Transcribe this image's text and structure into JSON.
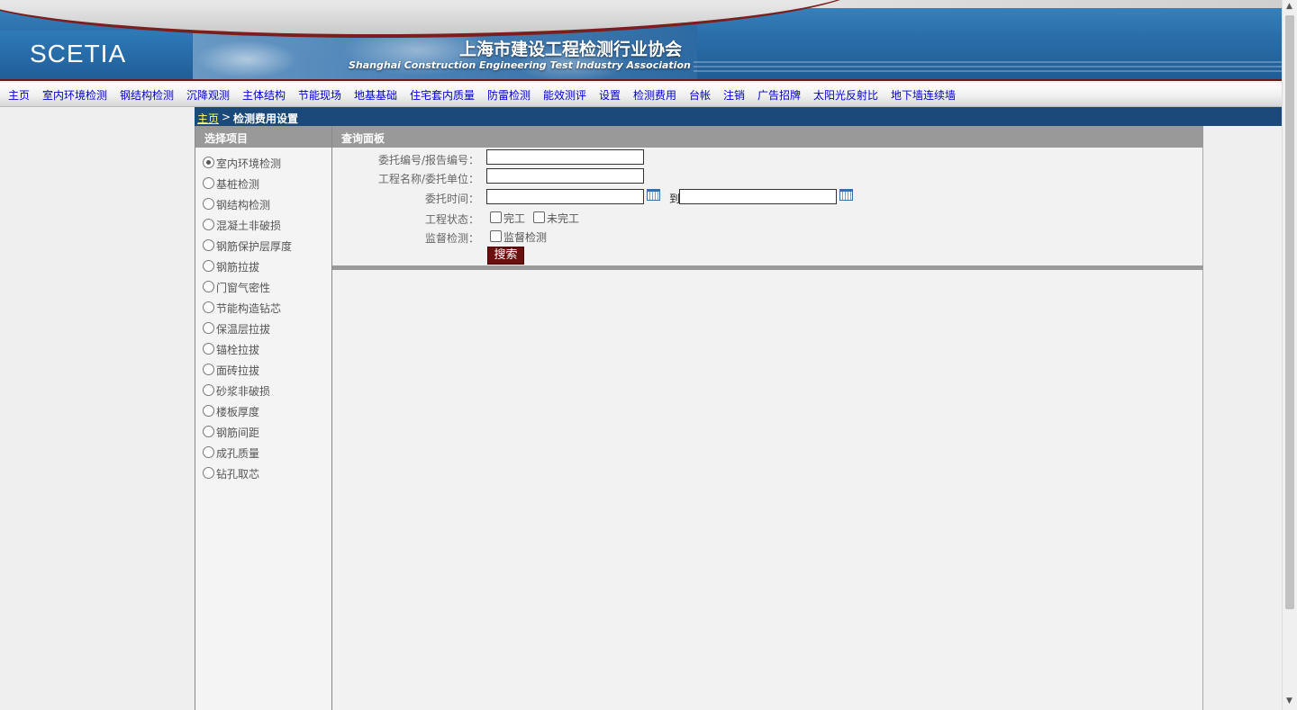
{
  "header": {
    "logo": "SCETIA",
    "title_cn": "上海市建设工程检测行业协会",
    "title_en": "Shanghai Construction Engineering Test Industry Association"
  },
  "nav": {
    "items": [
      {
        "label": "主页"
      },
      {
        "label": "室内环境检测"
      },
      {
        "label": "钢结构检测"
      },
      {
        "label": "沉降观测"
      },
      {
        "label": "主体结构"
      },
      {
        "label": "节能现场"
      },
      {
        "label": "地基基础"
      },
      {
        "label": "住宅套内质量"
      },
      {
        "label": "防雷检测"
      },
      {
        "label": "能效测评"
      },
      {
        "label": "设置"
      },
      {
        "label": "检测费用"
      },
      {
        "label": "台帐"
      },
      {
        "label": "注销"
      },
      {
        "label": "广告招牌"
      },
      {
        "label": "太阳光反射比"
      },
      {
        "label": "地下墙连续墙"
      }
    ]
  },
  "breadcrumb": {
    "home": "主页",
    "separator": ">",
    "current": "检测费用设置"
  },
  "left_panel": {
    "title": "选择项目",
    "selected_index": 0,
    "items": [
      {
        "label": "室内环境检测"
      },
      {
        "label": "基桩检测"
      },
      {
        "label": "钢结构检测"
      },
      {
        "label": "混凝土非破损"
      },
      {
        "label": "钢筋保护层厚度"
      },
      {
        "label": "钢筋拉拔"
      },
      {
        "label": "门窗气密性"
      },
      {
        "label": "节能构造钻芯"
      },
      {
        "label": "保温层拉拔"
      },
      {
        "label": "锚栓拉拔"
      },
      {
        "label": "面砖拉拔"
      },
      {
        "label": "砂浆非破损"
      },
      {
        "label": "楼板厚度"
      },
      {
        "label": "钢筋间距"
      },
      {
        "label": "成孔质量"
      },
      {
        "label": "钻孔取芯"
      }
    ]
  },
  "query_panel": {
    "title": "查询面板",
    "fields": {
      "number_label": "委托编号/报告编号：",
      "number_value": "",
      "project_label": "工程名称/委托单位：",
      "project_value": "",
      "time_label": "委托时间：",
      "time_from": "",
      "time_to_label": "到",
      "time_to": "",
      "status_label": "工程状态：",
      "status_done": "完工",
      "status_undone": "未完工",
      "supervise_label": "监督检测：",
      "supervise_option": "监督检测"
    },
    "search_button": "搜索"
  },
  "icons": {
    "calendar": "calendar-icon",
    "radio": "radio-icon",
    "checkbox": "checkbox-icon"
  },
  "colors": {
    "banner": "#2a6ea8",
    "breadcrumb_bg": "#1b4a7a",
    "panel_head": "#999999",
    "search_button": "#6b0f0f",
    "nav_link": "#0000cc"
  }
}
